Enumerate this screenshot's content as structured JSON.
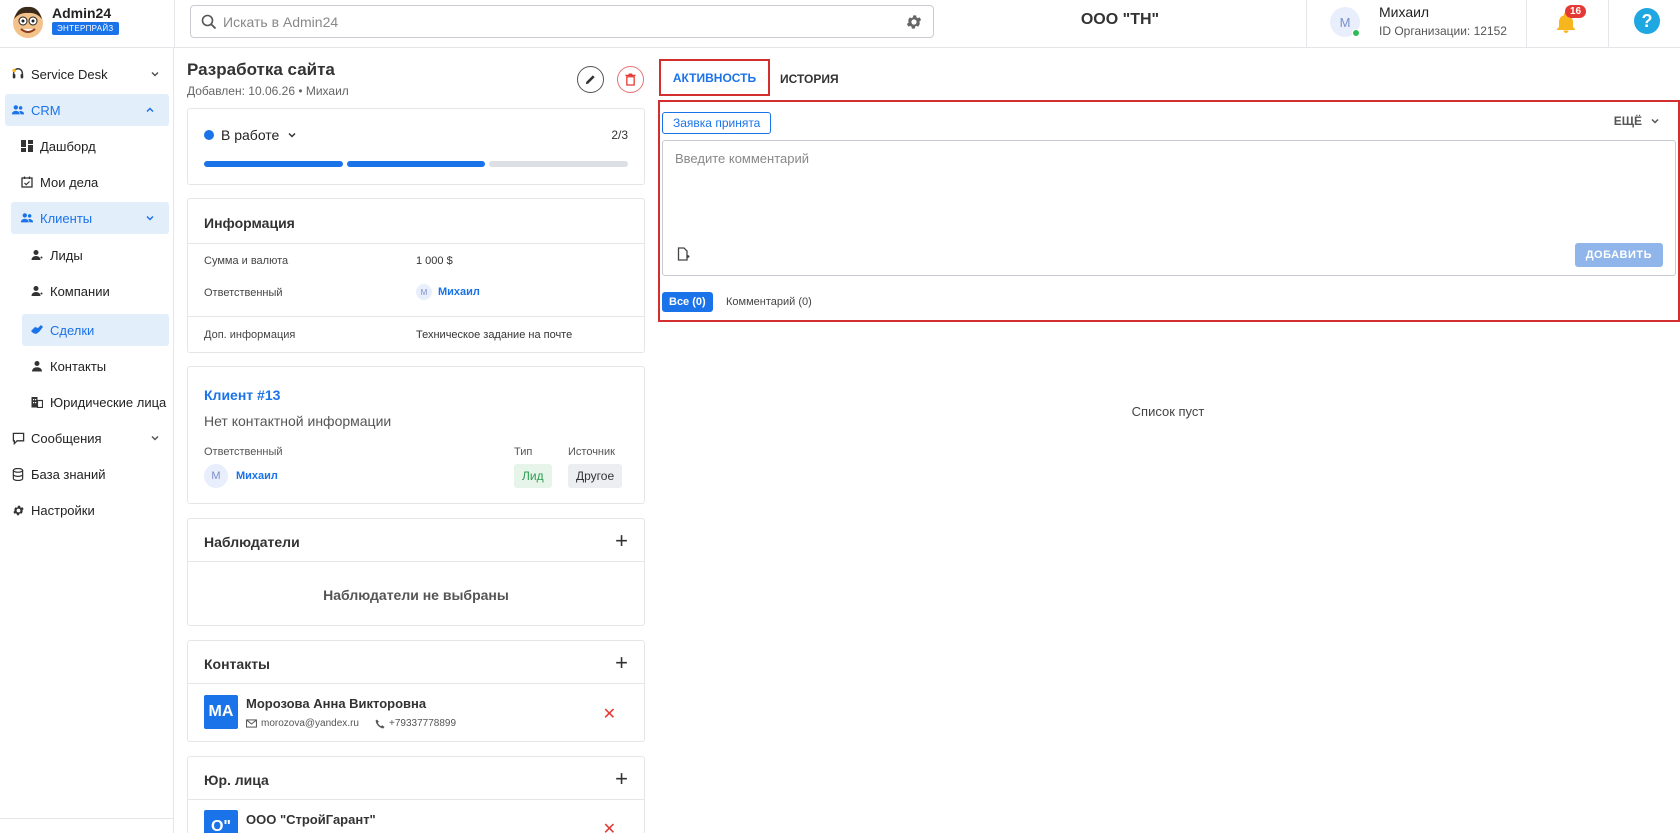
{
  "header": {
    "brand_name": "Admin24",
    "plan_badge": "ЭНТЕРПРАЙЗ",
    "search_placeholder": "Искать в Admin24",
    "org_name": "ООО \"ТН\"",
    "user_initial": "М",
    "user_name": "Михаил",
    "org_id": "ID Организации: 12152",
    "notifications_count": "16",
    "help": "?"
  },
  "sidebar": {
    "items": [
      {
        "label": "Service Desk",
        "icon": "headset-icon"
      },
      {
        "label": "CRM",
        "icon": "people-icon"
      },
      {
        "label": "Дашборд",
        "icon": "dashboard-icon"
      },
      {
        "label": "Мои дела",
        "icon": "calendar-check-icon"
      },
      {
        "label": "Клиенты",
        "icon": "people-icon"
      },
      {
        "label": "Лиды",
        "icon": "person-icon"
      },
      {
        "label": "Компании",
        "icon": "person-icon"
      },
      {
        "label": "Сделки",
        "icon": "handshake-icon"
      },
      {
        "label": "Контакты",
        "icon": "person-icon"
      },
      {
        "label": "Юридические лица",
        "icon": "building-icon"
      },
      {
        "label": "Сообщения",
        "icon": "chat-icon"
      },
      {
        "label": "База знаний",
        "icon": "database-icon"
      },
      {
        "label": "Настройки",
        "icon": "gear-icon"
      }
    ]
  },
  "deal": {
    "title": "Разработка сайта",
    "meta": "Добавлен: 10.06.26 • Михаил",
    "status": "В работе",
    "stage_count": "2/3",
    "stages_total": 3,
    "stages_done": 2
  },
  "info": {
    "title": "Информация",
    "rows": [
      {
        "label": "Сумма и валюта",
        "value": "1 000 $"
      },
      {
        "label": "Ответственный",
        "value": "Михаил",
        "avatar": "М"
      },
      {
        "label": "Доп. информация",
        "value": "Техническое задание на почте"
      }
    ]
  },
  "client": {
    "title": "Клиент #13",
    "no_contact": "Нет контактной информации",
    "resp_label": "Ответственный",
    "resp_avatar": "М",
    "resp_name": "Михаил",
    "type_label": "Тип",
    "type_value": "Лид",
    "source_label": "Источник",
    "source_value": "Другое"
  },
  "observers": {
    "title": "Наблюдатели",
    "add": "+",
    "empty": "Наблюдатели не выбраны"
  },
  "contacts": {
    "title": "Контакты",
    "add": "+",
    "items": [
      {
        "initials": "МА",
        "name": "Морозова Анна Викторовна",
        "email": "morozova@yandex.ru",
        "phone": "+79337778899",
        "remove": "✕"
      }
    ]
  },
  "legal": {
    "title": "Юр. лица",
    "add": "+",
    "items": [
      {
        "initials": "О\"",
        "name": "ООО \"СтройГарант\"",
        "remove": "✕"
      }
    ]
  },
  "activity": {
    "tabs": [
      "АКТИВНОСТЬ",
      "ИСТОРИЯ"
    ],
    "accepted_label": "Заявка принята",
    "more_label": "ЕЩЁ",
    "comment_placeholder": "Введите комментарий",
    "add_label": "ДОБАВИТЬ",
    "filter_all": "Все (0)",
    "filter_comments": "Комментарий (0)",
    "empty_list": "Список пуст"
  },
  "colors": {
    "accent": "#1a73e8",
    "highlight": "#d32f2f",
    "danger": "#e53935",
    "lead_tag_bg": "#e6f4ea",
    "lead_tag_text": "#2e9d4f"
  }
}
